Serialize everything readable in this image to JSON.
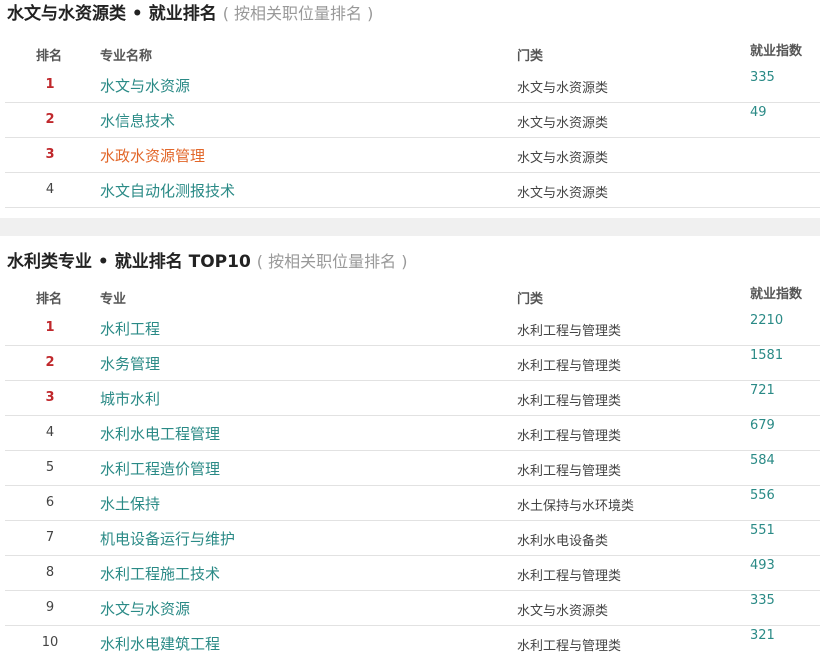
{
  "section1": {
    "title": "水文与水资源类 • 就业排名",
    "subtitle": "( 按相关职位量排名 )",
    "headers": {
      "rank": "排名",
      "name": "专业名称",
      "category": "门类",
      "index": "就业指数"
    },
    "rows": [
      {
        "rank": "1",
        "name": "水文与水资源",
        "category": "水文与水资源类",
        "index": "335"
      },
      {
        "rank": "2",
        "name": "水信息技术",
        "category": "水文与水资源类",
        "index": "49"
      },
      {
        "rank": "3",
        "name": "水政水资源管理",
        "category": "水文与水资源类",
        "index": ""
      },
      {
        "rank": "4",
        "name": "水文自动化测报技术",
        "category": "水文与水资源类",
        "index": ""
      }
    ]
  },
  "section2": {
    "title": "水利类专业 • 就业排名 TOP10",
    "subtitle": "( 按相关职位量排名 )",
    "headers": {
      "rank": "排名",
      "name": "专业",
      "category": "门类",
      "index": "就业指数"
    },
    "rows": [
      {
        "rank": "1",
        "name": "水利工程",
        "category": "水利工程与管理类",
        "index": "2210"
      },
      {
        "rank": "2",
        "name": "水务管理",
        "category": "水利工程与管理类",
        "index": "1581"
      },
      {
        "rank": "3",
        "name": "城市水利",
        "category": "水利工程与管理类",
        "index": "721"
      },
      {
        "rank": "4",
        "name": "水利水电工程管理",
        "category": "水利工程与管理类",
        "index": "679"
      },
      {
        "rank": "5",
        "name": "水利工程造价管理",
        "category": "水利工程与管理类",
        "index": "584"
      },
      {
        "rank": "6",
        "name": "水土保持",
        "category": "水土保持与水环境类",
        "index": "556"
      },
      {
        "rank": "7",
        "name": "机电设备运行与维护",
        "category": "水利水电设备类",
        "index": "551"
      },
      {
        "rank": "8",
        "name": "水利工程施工技术",
        "category": "水利工程与管理类",
        "index": "493"
      },
      {
        "rank": "9",
        "name": "水文与水资源",
        "category": "水文与水资源类",
        "index": "335"
      },
      {
        "rank": "10",
        "name": "水利水电建筑工程",
        "category": "水利工程与管理类",
        "index": "321"
      }
    ]
  }
}
